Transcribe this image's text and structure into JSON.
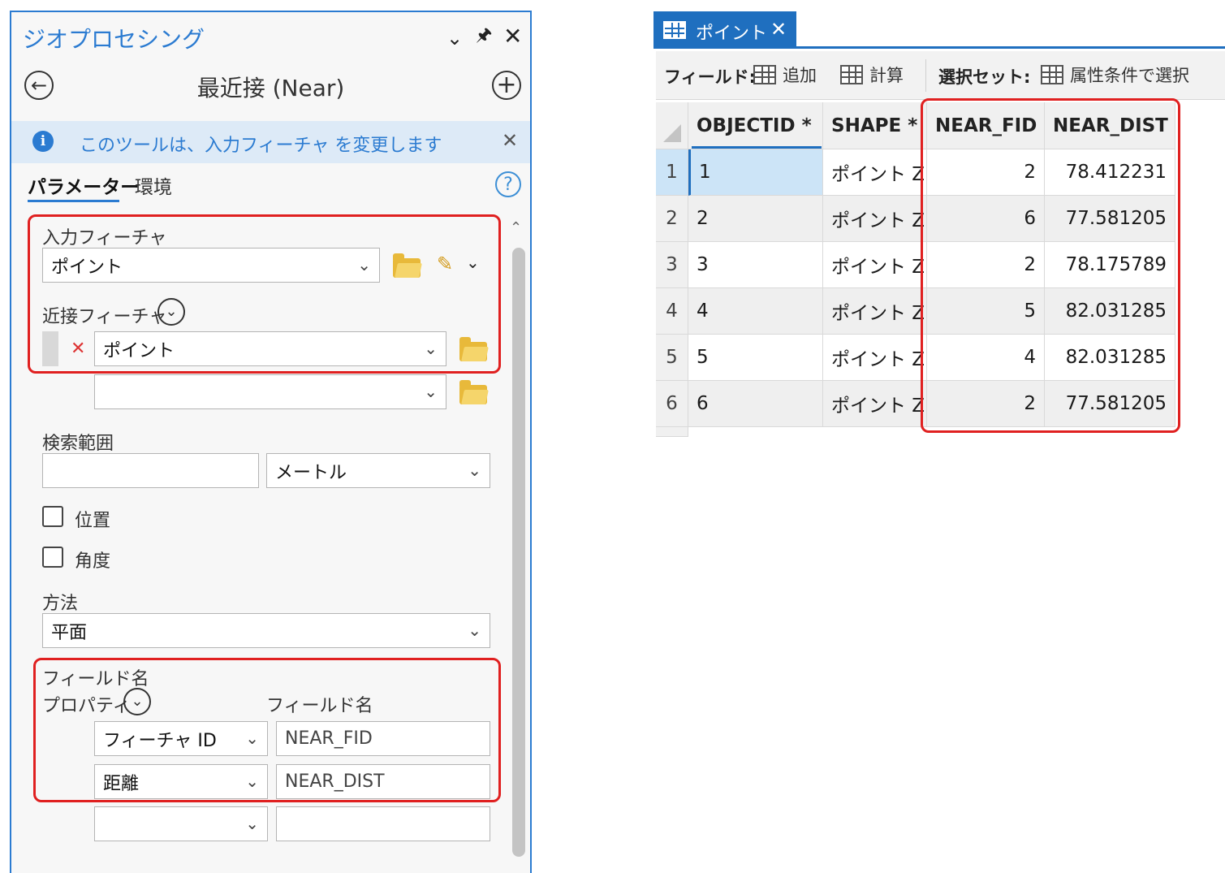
{
  "geoprocessing": {
    "pane_title": "ジオプロセシング",
    "tool_title": "最近接 (Near)",
    "info_message": "このツールは、入力フィーチャ を変更します",
    "tabs": [
      "パラメーター",
      "環境"
    ],
    "input_features_label": "入力フィーチャ",
    "input_features_value": "ポイント",
    "near_features_label": "近接フィーチャ",
    "near_features_value": "ポイント",
    "near_features_empty": "",
    "search_radius_label": "検索範囲",
    "search_radius_value": "",
    "search_radius_unit": "メートル",
    "location_label": "位置",
    "angle_label": "角度",
    "method_label": "方法",
    "method_value": "平面",
    "field_names_label": "フィールド名",
    "property_col_label": "プロパティ",
    "fieldname_col_label": "フィールド名",
    "field_rows": [
      {
        "property": "フィーチャ ID",
        "field": "NEAR_FID"
      },
      {
        "property": "距離",
        "field": "NEAR_DIST"
      },
      {
        "property": "",
        "field": ""
      }
    ]
  },
  "attribute_table": {
    "tab_label": "ポイント",
    "toolbar": {
      "fields_label": "フィールド:",
      "add_label": "追加",
      "calculate_label": "計算",
      "selection_label": "選択セット:",
      "select_by_attr_label": "属性条件で選択"
    },
    "columns": [
      "OBJECTID *",
      "SHAPE *",
      "NEAR_FID",
      "NEAR_DIST"
    ],
    "rows": [
      {
        "row": "1",
        "objectid": "1",
        "shape": "ポイント Z",
        "near_fid": "2",
        "near_dist": "78.412231"
      },
      {
        "row": "2",
        "objectid": "2",
        "shape": "ポイント Z",
        "near_fid": "6",
        "near_dist": "77.581205"
      },
      {
        "row": "3",
        "objectid": "3",
        "shape": "ポイント Z",
        "near_fid": "2",
        "near_dist": "78.175789"
      },
      {
        "row": "4",
        "objectid": "4",
        "shape": "ポイント Z",
        "near_fid": "5",
        "near_dist": "82.031285"
      },
      {
        "row": "5",
        "objectid": "5",
        "shape": "ポイント Z",
        "near_fid": "4",
        "near_dist": "82.031285"
      },
      {
        "row": "6",
        "objectid": "6",
        "shape": "ポイント Z",
        "near_fid": "2",
        "near_dist": "77.581205"
      }
    ]
  },
  "colors": {
    "accent_blue": "#2b7bd1",
    "highlight_red": "#e02020",
    "selected_cell": "#cce4f7"
  }
}
